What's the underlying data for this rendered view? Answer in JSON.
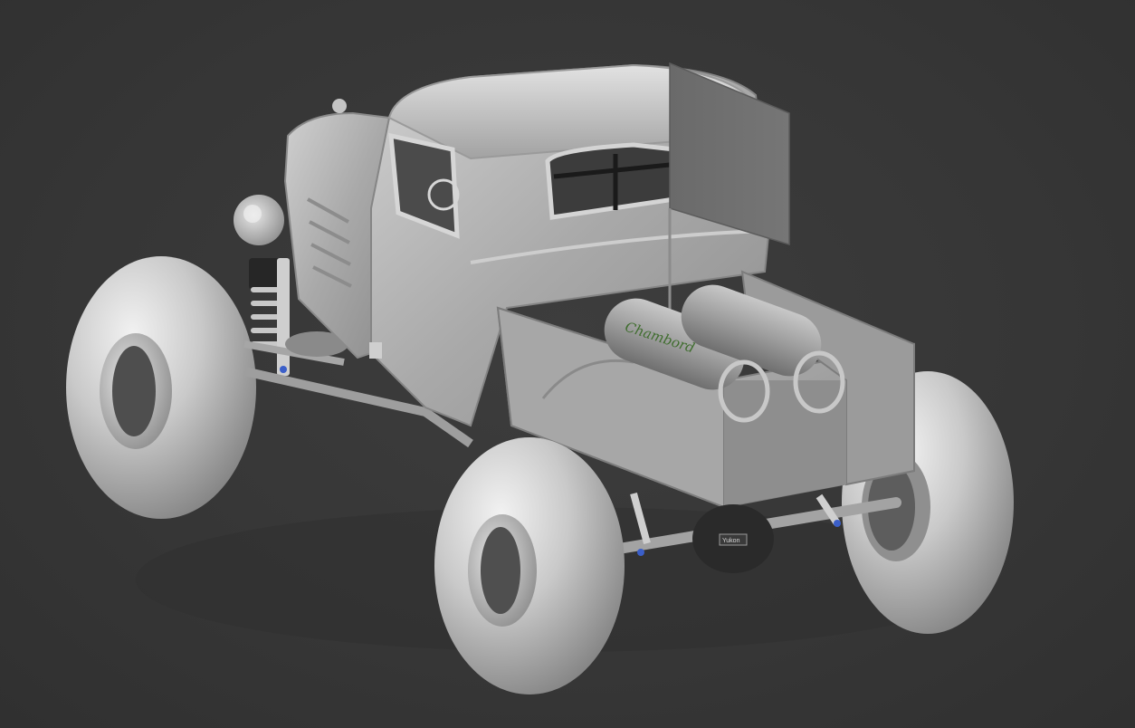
{
  "viewport": {
    "background_color": "#3a3a3a",
    "model_base_color": "#b9b9b9"
  },
  "model": {
    "description_icon": "3d-render-viewport",
    "tank_label": "Chambord",
    "tank_label_color": "#3f6d2e",
    "differential_label": "Yukon",
    "shock_accent_color": "#3b5fc9"
  }
}
